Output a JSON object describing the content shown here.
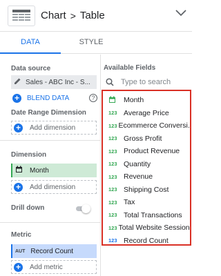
{
  "header": {
    "crumb_chart": "Chart",
    "crumb_sep": ">",
    "crumb_table": "Table"
  },
  "tabs": [
    {
      "label": "DATA"
    },
    {
      "label": "STYLE"
    }
  ],
  "left": {
    "data_source_label": "Data source",
    "data_source_value": "Sales - ABC Inc - S...",
    "blend_label": "BLEND DATA",
    "date_range_label": "Date Range Dimension",
    "add_dimension_1": "Add dimension",
    "dimension_label": "Dimension",
    "dimension_chip": "Month",
    "add_dimension_2": "Add dimension",
    "drill_down_label": "Drill down",
    "metric_label": "Metric",
    "metric_chip_tag": "AUT",
    "metric_chip": "Record Count",
    "add_metric": "Add metric"
  },
  "right": {
    "available_label": "Available Fields",
    "search_placeholder": "Type to search",
    "fields": [
      {
        "tag": "",
        "name": "Month"
      },
      {
        "tag": "123",
        "name": "Average Price"
      },
      {
        "tag": "123",
        "name": "Ecommerce Conversi..."
      },
      {
        "tag": "123",
        "name": "Gross Profit"
      },
      {
        "tag": "123",
        "name": "Product Revenue"
      },
      {
        "tag": "123",
        "name": "Quantity"
      },
      {
        "tag": "123",
        "name": "Revenue"
      },
      {
        "tag": "123",
        "name": "Shipping Cost"
      },
      {
        "tag": "123",
        "name": "Tax"
      },
      {
        "tag": "123",
        "name": "Total Transactions"
      },
      {
        "tag": "123",
        "name": "Total Website Sessions"
      },
      {
        "tag": "123",
        "name": "Record Count"
      }
    ]
  },
  "colors": {
    "accent": "#1a73e8",
    "dimension": "#34a853",
    "highlight_border": "#d93025"
  }
}
